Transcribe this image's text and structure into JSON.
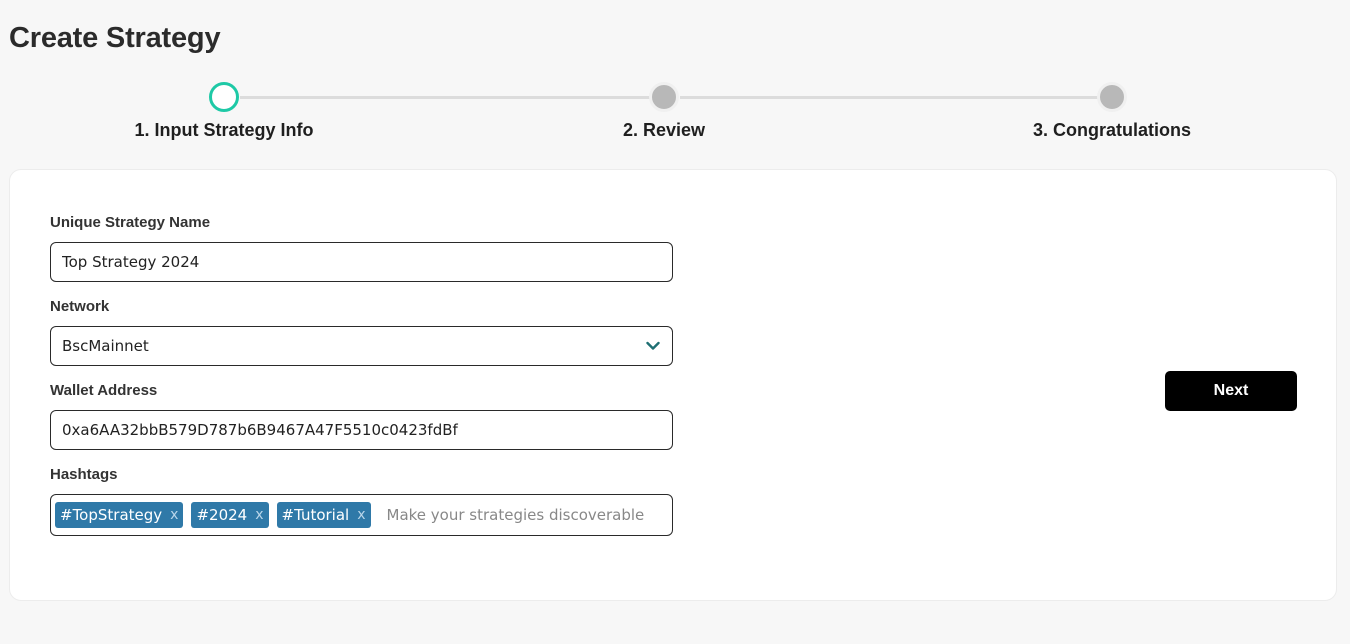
{
  "page": {
    "title": "Create Strategy"
  },
  "stepper": {
    "steps": [
      {
        "label": "1. Input Strategy Info",
        "state": "active"
      },
      {
        "label": "2. Review",
        "state": "pending"
      },
      {
        "label": "3. Congratulations",
        "state": "pending"
      }
    ],
    "colors": {
      "active": "#1ec9a6",
      "pending": "#b8b8b8"
    }
  },
  "form": {
    "strategy_name": {
      "label": "Unique Strategy Name",
      "value": "Top Strategy 2024"
    },
    "network": {
      "label": "Network",
      "value": "BscMainnet",
      "icon": "chevron-down-icon"
    },
    "wallet": {
      "label": "Wallet Address",
      "value": "0xa6AA32bbB579D787b6B9467A47F5510c0423fdBf"
    },
    "hashtags": {
      "label": "Hashtags",
      "tags": [
        "#TopStrategy",
        "#2024",
        "#Tutorial"
      ],
      "remove_glyph": "x",
      "placeholder": "Make your strategies discoverable",
      "tag_color": "#2f79a8"
    }
  },
  "actions": {
    "next_label": "Next"
  }
}
